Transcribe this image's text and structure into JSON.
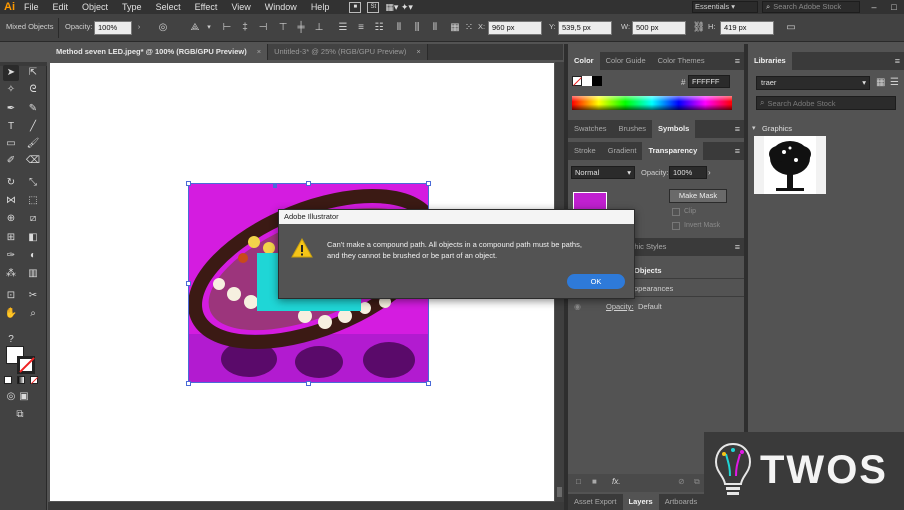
{
  "menubar": {
    "logo": "Ai",
    "items": [
      "File",
      "Edit",
      "Object",
      "Type",
      "Select",
      "Effect",
      "View",
      "Window",
      "Help"
    ],
    "essentials": "Essentials",
    "search_placeholder": "Search Adobe Stock"
  },
  "controlbar": {
    "selection_label": "Mixed Objects",
    "opacity_label": "Opacity:",
    "opacity_value": "100%",
    "x_label": "X:",
    "x_value": "960 px",
    "y_label": "Y:",
    "y_value": "539,5 px",
    "w_label": "W:",
    "w_value": "500 px",
    "h_label": "H:",
    "h_value": "419 px"
  },
  "tabs": [
    {
      "label": "Method seven LED.jpeg* @ 100% (RGB/GPU Preview)",
      "close": "×"
    },
    {
      "label": "Untitled-3* @ 25% (RGB/GPU Preview)",
      "close": "×"
    }
  ],
  "color_panel": {
    "tabs": [
      "Color",
      "Color Guide",
      "Color Themes"
    ],
    "hash": "#",
    "hex": "FFFFFF"
  },
  "swatches_panel": {
    "tabs": [
      "Swatches",
      "Brushes",
      "Symbols"
    ]
  },
  "transparency_panel": {
    "tabs": [
      "Stroke",
      "Gradient",
      "Transparency"
    ],
    "blend_mode": "Normal",
    "opacity_label": "Opacity:",
    "opacity_value": "100%",
    "make_mask": "Make Mask",
    "clip": "Clip",
    "invert_mask": "Invert Mask"
  },
  "appearance_panel": {
    "tab_partial": "aphic Styles",
    "objects_label": "Objects",
    "appearances_label": "ppearances",
    "opacity_label": "Opacity:",
    "opacity_value": "Default"
  },
  "bottom_tabs": [
    "Asset Export",
    "Layers",
    "Artboards"
  ],
  "libraries_panel": {
    "tab": "Libraries",
    "library_name": "traer",
    "search_placeholder": "Search Adobe Stock",
    "section": "Graphics"
  },
  "dialog": {
    "title": "Adobe Illustrator",
    "message_line1": "Can't make a compound path. All objects in a compound path must be paths,",
    "message_line2": "and they cannot be brushed or be part of an object.",
    "ok": "OK"
  },
  "watermark": {
    "text": "TWOS"
  },
  "colors": {
    "accent": "#2e7ad9",
    "logo": "#ff9a00",
    "magenta": "#e218e8",
    "cyan": "#1fd6d6",
    "warning": "#f5c518"
  }
}
